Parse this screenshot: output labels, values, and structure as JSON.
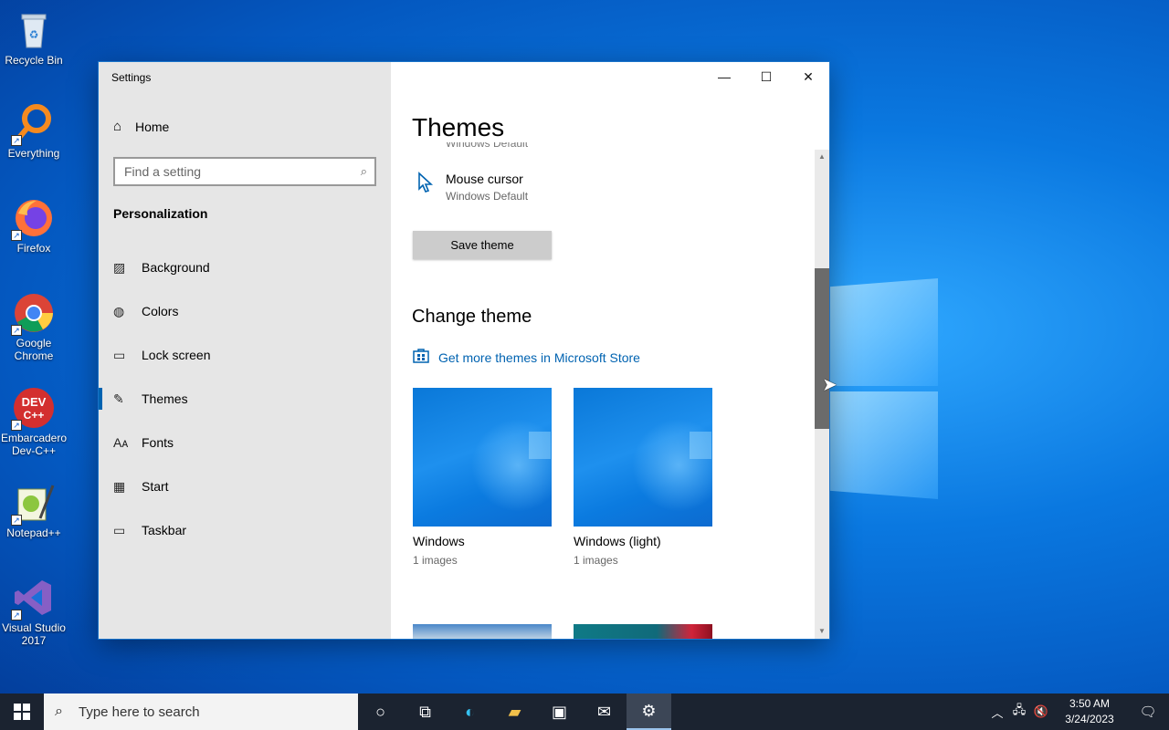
{
  "desktop": {
    "icons": [
      {
        "label": "Recycle Bin",
        "icon": "recycle-bin-icon"
      },
      {
        "label": "Everything",
        "icon": "everything-search-icon"
      },
      {
        "label": "Firefox",
        "icon": "firefox-icon"
      },
      {
        "label": "Google Chrome",
        "icon": "chrome-icon"
      },
      {
        "label": "Embarcadero Dev-C++",
        "icon": "devcpp-icon"
      },
      {
        "label": "Notepad++",
        "icon": "notepadpp-icon"
      },
      {
        "label": "Visual Studio 2017",
        "icon": "visual-studio-icon"
      }
    ]
  },
  "window": {
    "title": "Settings",
    "controls": {
      "minimize": "—",
      "maximize": "☐",
      "close": "✕"
    }
  },
  "sidebar": {
    "home_label": "Home",
    "search_placeholder": "Find a setting",
    "section": "Personalization",
    "items": [
      {
        "label": "Background",
        "icon": "picture-icon",
        "glyph": "▨"
      },
      {
        "label": "Colors",
        "icon": "palette-icon",
        "glyph": "◍"
      },
      {
        "label": "Lock screen",
        "icon": "lock-screen-icon",
        "glyph": "▭"
      },
      {
        "label": "Themes",
        "icon": "brush-icon",
        "glyph": "✎"
      },
      {
        "label": "Fonts",
        "icon": "fonts-icon",
        "glyph": "Aᴀ"
      },
      {
        "label": "Start",
        "icon": "start-icon",
        "glyph": "▦"
      },
      {
        "label": "Taskbar",
        "icon": "taskbar-icon",
        "glyph": "▭"
      }
    ],
    "active_index": 3
  },
  "main": {
    "title": "Themes",
    "cut_text": "Windows Default",
    "mouse_cursor": {
      "label": "Mouse cursor",
      "value": "Windows Default"
    },
    "save_button": "Save theme",
    "change_heading": "Change theme",
    "store_link": "Get more themes in Microsoft Store",
    "themes": [
      {
        "name": "Windows",
        "count": "1 images"
      },
      {
        "name": "Windows (light)",
        "count": "1 images"
      }
    ]
  },
  "taskbar": {
    "search_placeholder": "Type here to search",
    "apps": [
      {
        "icon": "cortana-icon",
        "glyph": "○"
      },
      {
        "icon": "task-view-icon",
        "glyph": "⧉"
      },
      {
        "icon": "edge-icon",
        "glyph": "◐"
      },
      {
        "icon": "file-explorer-icon",
        "glyph": "▰"
      },
      {
        "icon": "store-icon",
        "glyph": "▣"
      },
      {
        "icon": "mail-icon",
        "glyph": "✉"
      },
      {
        "icon": "settings-icon",
        "glyph": "⚙"
      }
    ],
    "time": "3:50 AM",
    "date": "3/24/2023"
  },
  "colors": {
    "accent": "#0063b1",
    "taskbar": "#1b2330"
  }
}
